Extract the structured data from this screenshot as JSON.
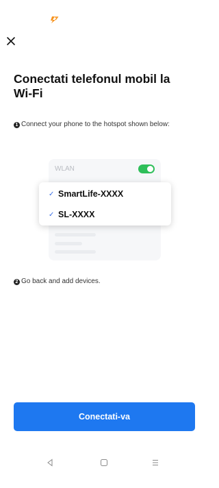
{
  "header": {
    "close_icon": "close-icon",
    "logo_icon": "brand-logo-icon",
    "accent_color": "#f7931e"
  },
  "title": "Conectati telefonul mobil la Wi-Fi",
  "steps": [
    {
      "num": "1",
      "text": "Connect your phone to the hotspot shown below:"
    },
    {
      "num": "2",
      "text": "Go back and add devices."
    }
  ],
  "illustration": {
    "wlan_label": "WLAN",
    "toggle_on": true,
    "toggle_color": "#2fbf5a",
    "networks": [
      {
        "check": "✓",
        "name": "SmartLife-XXXX"
      },
      {
        "check": "✓",
        "name": "SL-XXXX"
      }
    ]
  },
  "cta": {
    "label": "Conectati-va",
    "color": "#1e78f0"
  },
  "system_nav": {
    "back_icon": "nav-back-icon",
    "home_icon": "nav-home-icon",
    "menu_icon": "nav-menu-icon"
  }
}
